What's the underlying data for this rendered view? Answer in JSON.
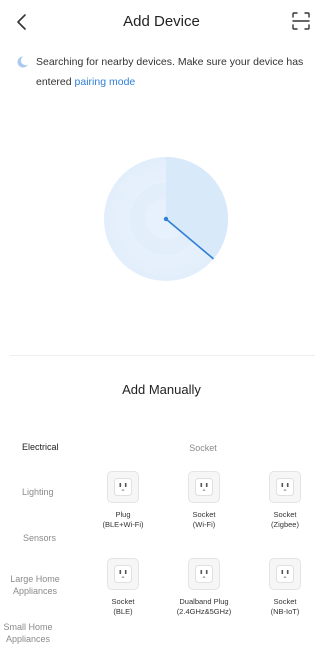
{
  "header": {
    "title": "Add Device",
    "back_icon": "chevron-left-icon",
    "scan_icon": "scan-icon"
  },
  "info": {
    "text": "Searching for nearby devices. Make sure your device has entered",
    "link": "pairing mode",
    "icon": "searching-moon-icon"
  },
  "manual": {
    "title": "Add Manually"
  },
  "categories": [
    {
      "label": "Electrical",
      "active": true
    },
    {
      "label": "Lighting"
    },
    {
      "label": "Sensors"
    },
    {
      "label": "Large Home Appliances"
    },
    {
      "label": "Small Home Appliances"
    }
  ],
  "subcategory": "Socket",
  "devices": [
    {
      "line1": "Plug",
      "line2": "(BLE+Wi-Fi)",
      "icon": "socket-icon"
    },
    {
      "line1": "Socket",
      "line2": "(Wi-Fi)",
      "icon": "socket-icon"
    },
    {
      "line1": "Socket",
      "line2": "(Zigbee)",
      "icon": "socket-icon"
    },
    {
      "line1": "Socket",
      "line2": "(BLE)",
      "icon": "socket-icon"
    },
    {
      "line1": "Dualband Plug",
      "line2": "(2.4GHz&5GHz)",
      "icon": "socket-icon"
    },
    {
      "line1": "Socket",
      "line2": "(NB-IoT)",
      "icon": "socket-icon"
    }
  ],
  "colors": {
    "accent": "#2f7fd8",
    "radar": "#dcebfa"
  }
}
